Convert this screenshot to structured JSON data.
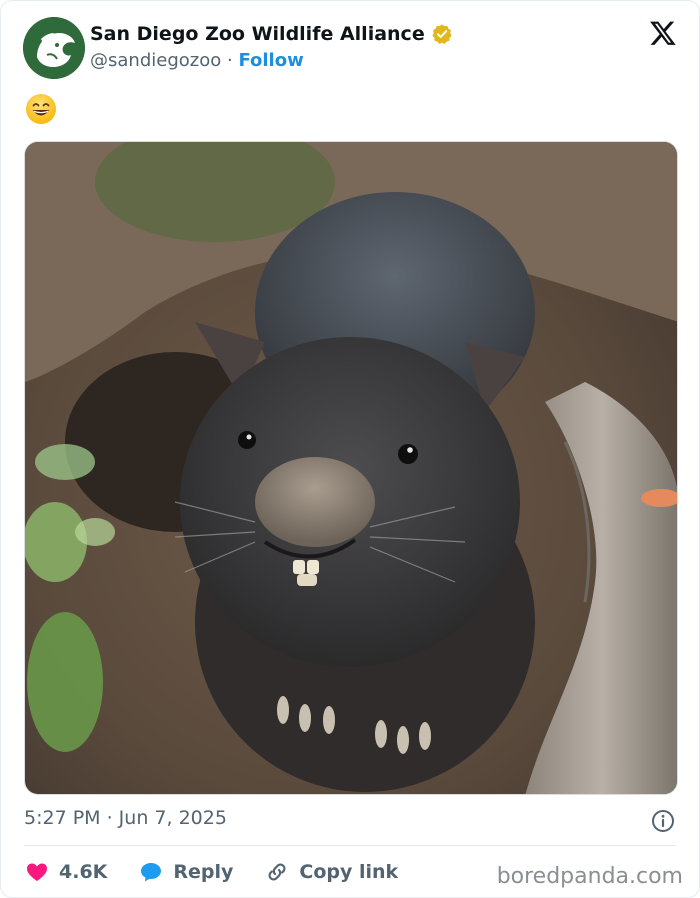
{
  "author": {
    "display_name": "San Diego Zoo Wildlife Alliance",
    "handle": "@sandiegozoo",
    "separator": "·",
    "follow_label": "Follow"
  },
  "post": {
    "emoji": "grinning-face-emoji",
    "timestamp": "5:27 PM · Jun 7, 2025"
  },
  "actions": {
    "like_count": "4.6K",
    "reply_label": "Reply",
    "copy_link_label": "Copy link"
  },
  "watermark": "boredpanda.com",
  "colors": {
    "accent": "#1d8fe0",
    "like": "#f91880",
    "reply": "#1d9bf0",
    "verified": "#e2b719",
    "avatar": "#2f6b3a"
  },
  "icons": [
    "x-logo-icon",
    "verified-badge-icon",
    "info-icon",
    "heart-icon",
    "reply-bubble-icon",
    "link-icon"
  ]
}
